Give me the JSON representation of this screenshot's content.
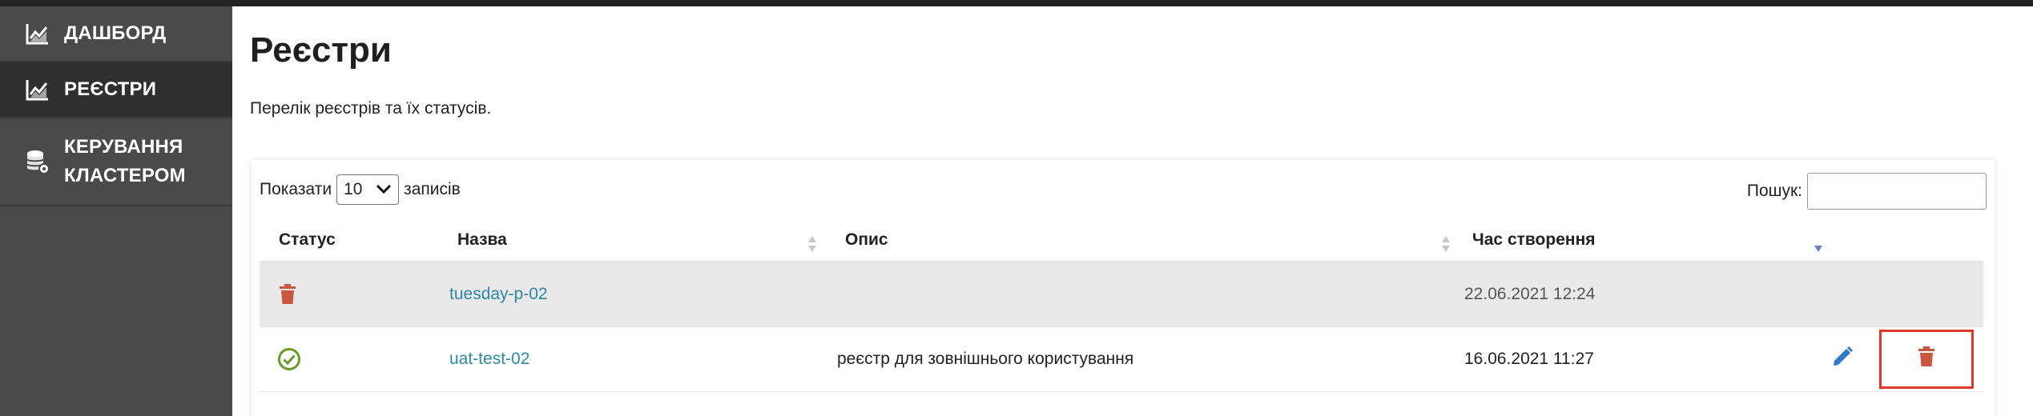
{
  "sidebar": {
    "items": [
      {
        "label": "ДАШБОРД",
        "icon": "chart-icon"
      },
      {
        "label": "РЕЄСТРИ",
        "icon": "chart-icon",
        "active": true
      },
      {
        "label_line1": "КЕРУВАННЯ",
        "label_line2": "КЛАСТЕРОМ",
        "icon": "database-gear-icon"
      }
    ]
  },
  "page": {
    "title": "Реєстри",
    "description": "Перелік реєстрів та їх статусів."
  },
  "table_controls": {
    "show_label": "Показати",
    "page_size": "10",
    "records_label": "записів",
    "search_label": "Пошук:",
    "search_value": ""
  },
  "table": {
    "columns": {
      "status": "Статус",
      "name": "Назва",
      "description": "Опис",
      "created": "Час створення"
    },
    "rows": [
      {
        "status": "deleted",
        "name": "tuesday-p-02",
        "description": "",
        "created": "22.06.2021 12:24"
      },
      {
        "status": "ok",
        "name": "uat-test-02",
        "description": "реєстр для зовнішнього користування",
        "created": "16.06.2021 11:27"
      }
    ]
  },
  "colors": {
    "accent_link": "#2f87a4",
    "delete_red": "#c9563e",
    "ok_green": "#6a9a2a",
    "edit_blue": "#2f7ac6",
    "highlight_red": "#e03a2a"
  }
}
